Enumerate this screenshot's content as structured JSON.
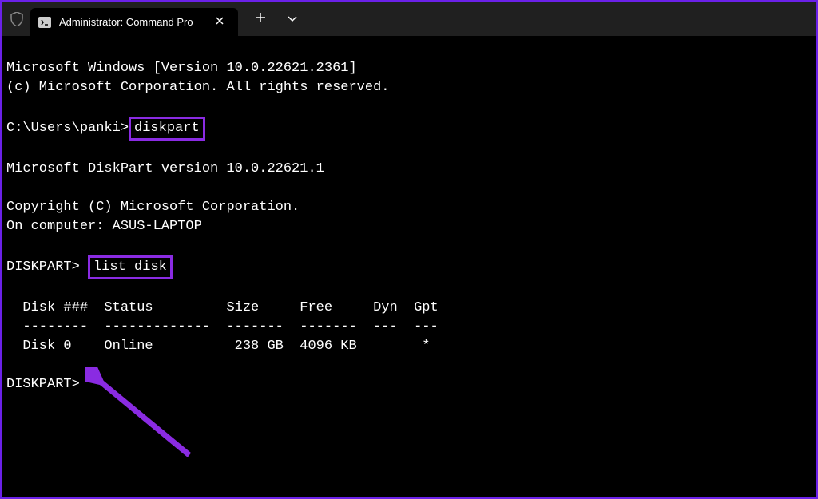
{
  "titleBar": {
    "tab": {
      "title": "Administrator: Command Pro"
    }
  },
  "terminal": {
    "line1": "Microsoft Windows [Version 10.0.22621.2361]",
    "line2": "(c) Microsoft Corporation. All rights reserved.",
    "prompt1_prefix": "C:\\Users\\panki>",
    "prompt1_cmd": "diskpart",
    "line4": "Microsoft DiskPart version 10.0.22621.1",
    "line5": "Copyright (C) Microsoft Corporation.",
    "line6": "On computer: ASUS-LAPTOP",
    "prompt2_prefix": "DISKPART> ",
    "prompt2_cmd": "list disk",
    "table_header": "  Disk ###  Status         Size     Free     Dyn  Gpt",
    "table_divider": "  --------  -------------  -------  -------  ---  ---",
    "table_row1": "  Disk 0    Online          238 GB  4096 KB        *",
    "prompt3": "DISKPART>"
  },
  "colors": {
    "highlight": "#8a2be2",
    "background": "#000000",
    "titlebar": "#202020"
  }
}
